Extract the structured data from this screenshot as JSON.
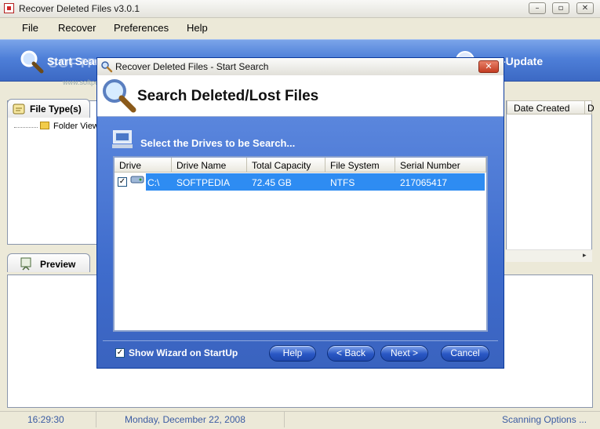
{
  "window": {
    "title": "Recover Deleted Files v3.0.1",
    "controls": {
      "minimize": "–",
      "maximize": "▫",
      "close": "✕"
    }
  },
  "menu": {
    "items": [
      "File",
      "Recover",
      "Preferences",
      "Help"
    ]
  },
  "toolbar": {
    "start_search": "Start Search",
    "update": "-Update",
    "watermark": "SOFTPEDIA",
    "watermark_url": "www.softpedia.com"
  },
  "left_panel": {
    "tab_file_types": "File Type(s)",
    "tree_item": "Folder View",
    "tab_preview": "Preview"
  },
  "right_list": {
    "columns": [
      "Date Created",
      "D"
    ]
  },
  "statusbar": {
    "time": "16:29:30",
    "date": "Monday, December 22, 2008",
    "scanning": "Scanning Options ..."
  },
  "dialog": {
    "title": "Recover Deleted Files - Start Search",
    "close": "✕",
    "heading": "Search Deleted/Lost Files",
    "subtitle": "Select the Drives to be Search...",
    "drive_table": {
      "columns": [
        "Drive",
        "Drive Name",
        "Total Capacity",
        "File System",
        "Serial Number"
      ],
      "rows": [
        {
          "checked": "✓",
          "drive": "C:\\",
          "name": "SOFTPEDIA",
          "capacity": "72.45 GB",
          "fs": "NTFS",
          "serial": "217065417"
        }
      ]
    },
    "show_wizard_checked": "✓",
    "show_wizard_label": "Show Wizard on StartUp",
    "buttons": {
      "help": "Help",
      "back": "< Back",
      "next": "Next >",
      "cancel": "Cancel"
    }
  },
  "colors": {
    "toolbar_blue": "#4e7fd8",
    "dialog_blue": "#3a63bf",
    "row_selected": "#2e8cf2",
    "status_text": "#3b5ca3"
  }
}
